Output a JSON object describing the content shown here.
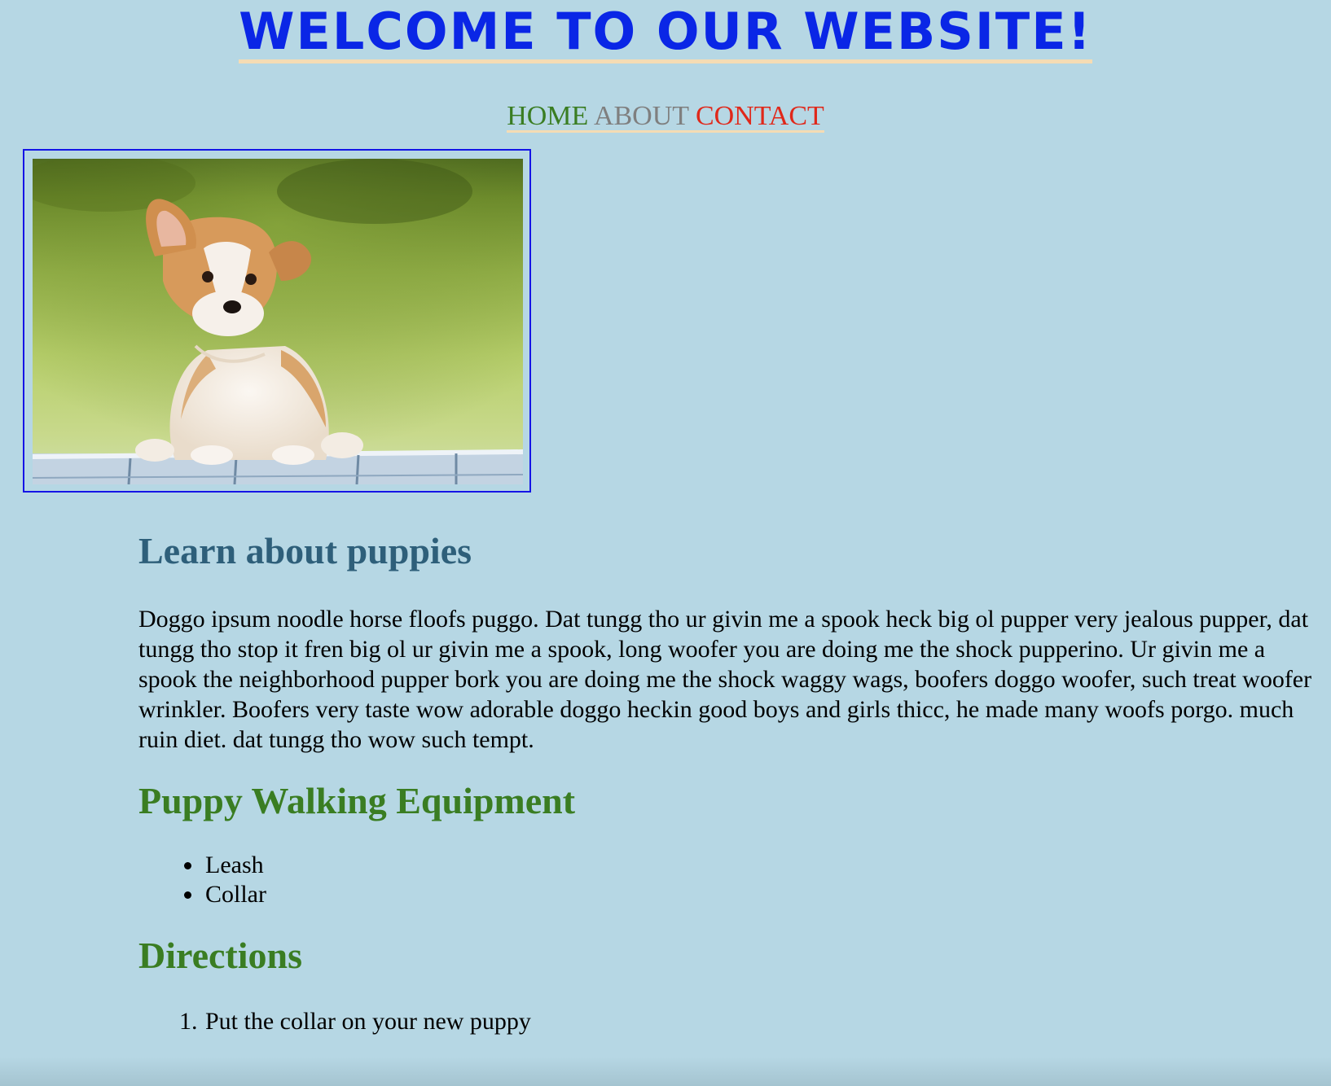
{
  "header": {
    "title": "WELCOME TO OUR WEBSITE!",
    "title_color": "#0a26e6",
    "underline_color": "#f5dcb4"
  },
  "nav": {
    "items": [
      {
        "label": "HOME",
        "color": "#3a7d22"
      },
      {
        "label": "ABOUT",
        "color": "#7f7f7f"
      },
      {
        "label": "CONTACT",
        "color": "#e0281a"
      }
    ]
  },
  "hero": {
    "image": "corgi-puppy-photo",
    "frame_color": "#1414e6"
  },
  "sections": {
    "learn": {
      "heading": "Learn about puppies",
      "heading_color": "#2e5f7a",
      "paragraph": "Doggo ipsum noodle horse floofs puggo. Dat tungg tho ur givin me a spook heck big ol pupper very jealous pupper, dat tungg tho stop it fren big ol ur givin me a spook, long woofer you are doing me the shock pupperino. Ur givin me a spook the neighborhood pupper bork you are doing me the shock waggy wags, boofers doggo woofer, such treat woofer wrinkler. Boofers very taste wow adorable doggo heckin good boys and girls thicc, he made many woofs porgo. much ruin diet. dat tungg tho wow such tempt."
    },
    "equipment": {
      "heading": "Puppy Walking Equipment",
      "heading_color": "#3a7d22",
      "items": [
        "Leash",
        "Collar"
      ]
    },
    "directions": {
      "heading": "Directions",
      "heading_color": "#3a7d22",
      "steps": [
        "Put the collar on your new puppy"
      ]
    }
  },
  "colors": {
    "background": "#b6d7e4",
    "text": "#000000"
  }
}
